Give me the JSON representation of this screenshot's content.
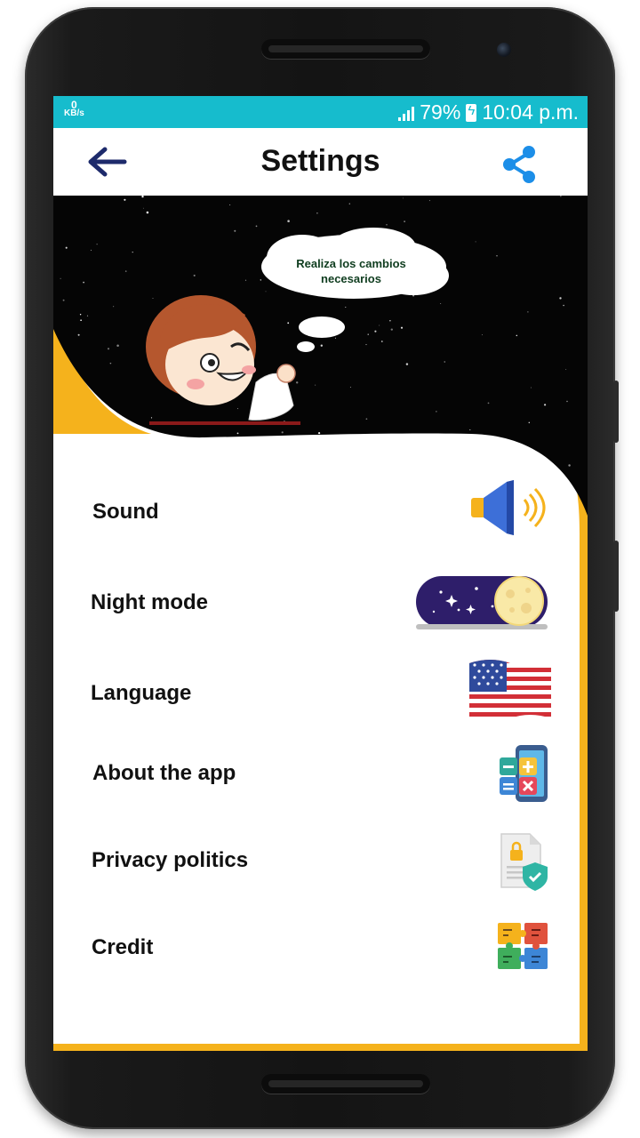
{
  "status_bar": {
    "speed_value": "0",
    "speed_unit": "KB/s",
    "battery": "79%",
    "time": "10:04 p.m."
  },
  "app_bar": {
    "title": "Settings"
  },
  "hero": {
    "bubble_text": "Realiza los cambios necesarios"
  },
  "settings": [
    {
      "label": "Sound",
      "icon": "speaker-icon"
    },
    {
      "label": "Night mode",
      "icon": "night-mode-toggle"
    },
    {
      "label": "Language",
      "icon": "us-flag-icon"
    },
    {
      "label": "About the app",
      "icon": "calculator-phone-icon"
    },
    {
      "label": "Privacy politics",
      "icon": "privacy-document-icon"
    },
    {
      "label": "Credit",
      "icon": "puzzle-icon"
    }
  ],
  "colors": {
    "status_bar": "#16bccd",
    "accent_yellow": "#f5b21c",
    "share_blue": "#1c8ee8",
    "back_navy": "#1d2a6b",
    "night_purple": "#2e1e6a"
  }
}
